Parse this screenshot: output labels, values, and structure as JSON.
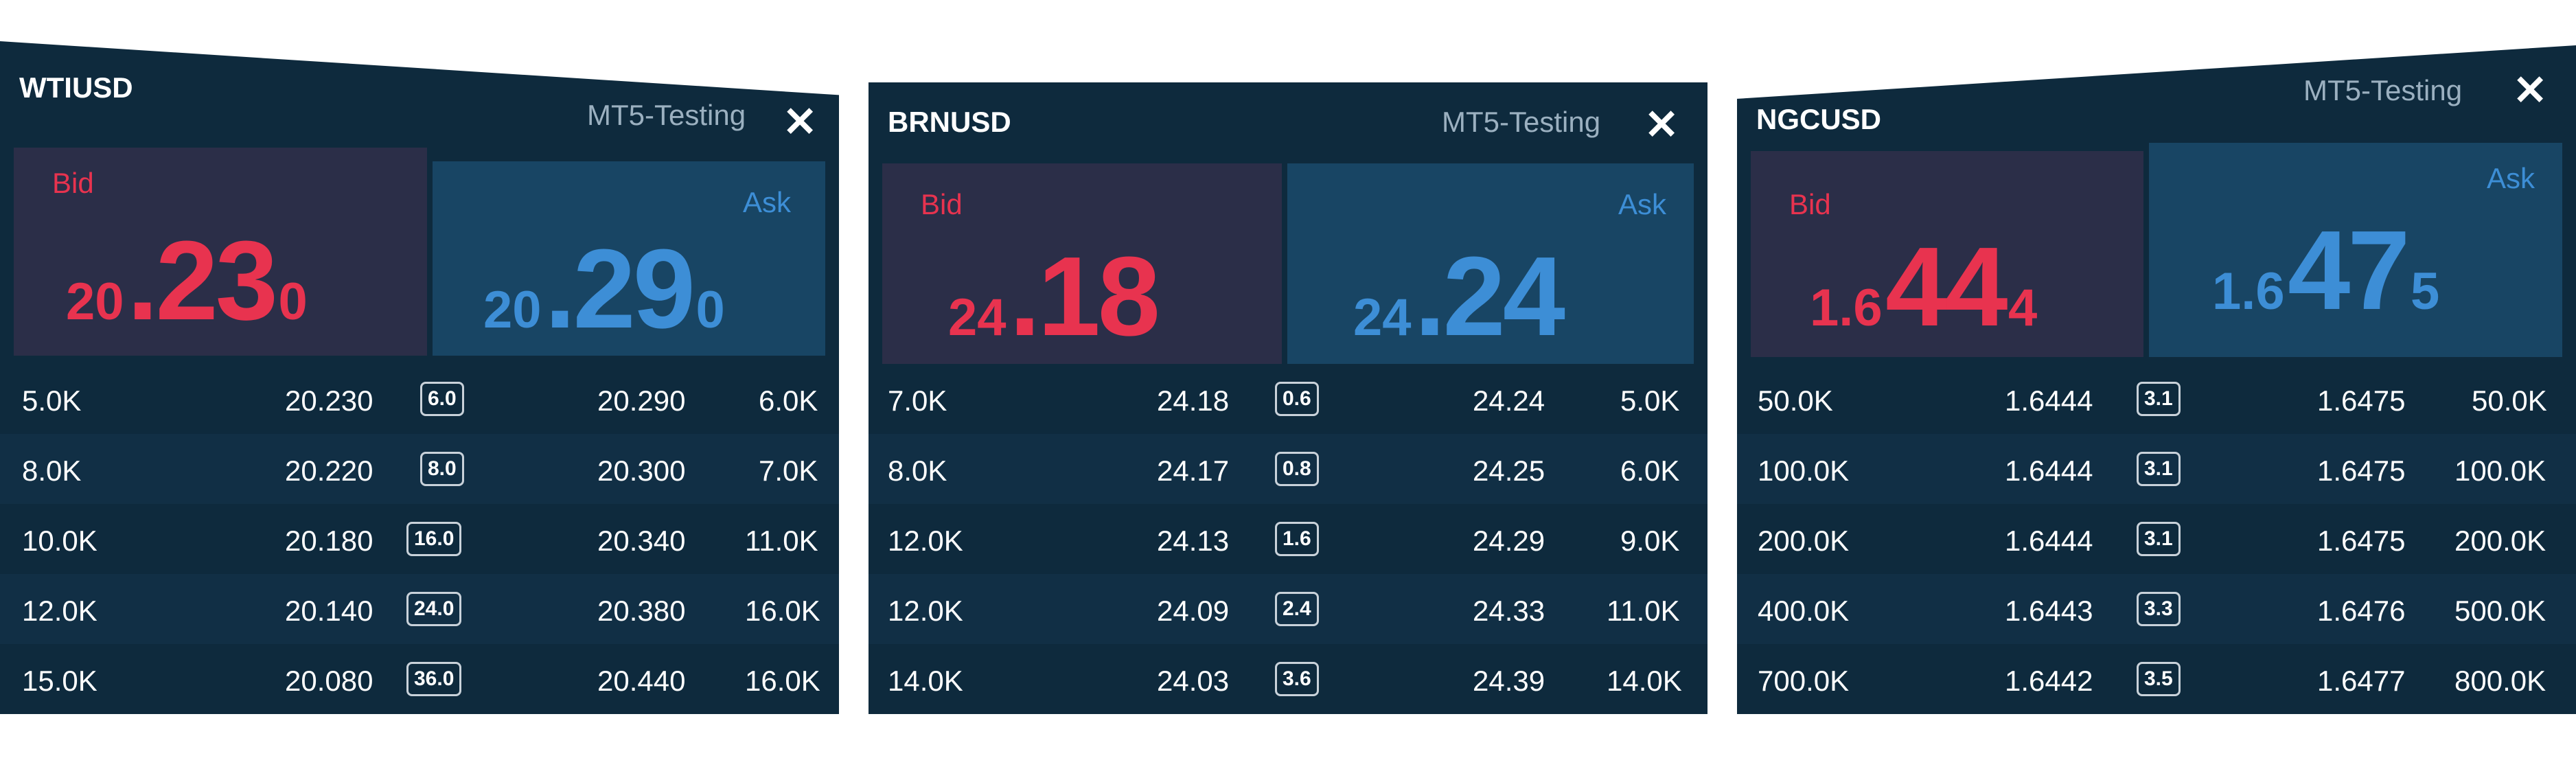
{
  "panels": [
    {
      "symbol": "WTIUSD",
      "server": "MT5-Testing",
      "close_icon": "✕",
      "bid": {
        "label": "Bid",
        "pre": "20",
        "big": ".23",
        "suf": "0"
      },
      "ask": {
        "label": "Ask",
        "pre": "20",
        "big": ".29",
        "suf": "0"
      },
      "rows": [
        {
          "bid_vol": "5.0K",
          "bid": "20.230",
          "spread": "6.0",
          "ask": "20.290",
          "ask_vol": "6.0K"
        },
        {
          "bid_vol": "8.0K",
          "bid": "20.220",
          "spread": "8.0",
          "ask": "20.300",
          "ask_vol": "7.0K"
        },
        {
          "bid_vol": "10.0K",
          "bid": "20.180",
          "spread": "16.0",
          "ask": "20.340",
          "ask_vol": "11.0K"
        },
        {
          "bid_vol": "12.0K",
          "bid": "20.140",
          "spread": "24.0",
          "ask": "20.380",
          "ask_vol": "16.0K"
        },
        {
          "bid_vol": "15.0K",
          "bid": "20.080",
          "spread": "36.0",
          "ask": "20.440",
          "ask_vol": "16.0K"
        }
      ]
    },
    {
      "symbol": "BRNUSD",
      "server": "MT5-Testing",
      "close_icon": "✕",
      "bid": {
        "label": "Bid",
        "pre": "24",
        "big": ".18",
        "suf": ""
      },
      "ask": {
        "label": "Ask",
        "pre": "24",
        "big": ".24",
        "suf": ""
      },
      "rows": [
        {
          "bid_vol": "7.0K",
          "bid": "24.18",
          "spread": "0.6",
          "ask": "24.24",
          "ask_vol": "5.0K"
        },
        {
          "bid_vol": "8.0K",
          "bid": "24.17",
          "spread": "0.8",
          "ask": "24.25",
          "ask_vol": "6.0K"
        },
        {
          "bid_vol": "12.0K",
          "bid": "24.13",
          "spread": "1.6",
          "ask": "24.29",
          "ask_vol": "9.0K"
        },
        {
          "bid_vol": "12.0K",
          "bid": "24.09",
          "spread": "2.4",
          "ask": "24.33",
          "ask_vol": "11.0K"
        },
        {
          "bid_vol": "14.0K",
          "bid": "24.03",
          "spread": "3.6",
          "ask": "24.39",
          "ask_vol": "14.0K"
        }
      ]
    },
    {
      "symbol": "NGCUSD",
      "server": "MT5-Testing",
      "close_icon": "✕",
      "bid": {
        "label": "Bid",
        "pre": "1.6",
        "big": "44",
        "suf": "4"
      },
      "ask": {
        "label": "Ask",
        "pre": "1.6",
        "big": "47",
        "suf": "5"
      },
      "rows": [
        {
          "bid_vol": "50.0K",
          "bid": "1.6444",
          "spread": "3.1",
          "ask": "1.6475",
          "ask_vol": "50.0K"
        },
        {
          "bid_vol": "100.0K",
          "bid": "1.6444",
          "spread": "3.1",
          "ask": "1.6475",
          "ask_vol": "100.0K"
        },
        {
          "bid_vol": "200.0K",
          "bid": "1.6444",
          "spread": "3.1",
          "ask": "1.6475",
          "ask_vol": "200.0K"
        },
        {
          "bid_vol": "400.0K",
          "bid": "1.6443",
          "spread": "3.3",
          "ask": "1.6476",
          "ask_vol": "500.0K"
        },
        {
          "bid_vol": "700.0K",
          "bid": "1.6442",
          "spread": "3.5",
          "ask": "1.6477",
          "ask_vol": "800.0K"
        }
      ]
    }
  ],
  "colors": {
    "panel_bg": "#0e2a3d",
    "bid_bg": "#2b2e48",
    "ask_bg": "#184564",
    "bid_text": "#e8334f",
    "ask_text": "#3d8ed6",
    "server_text": "#9bb0c0"
  }
}
